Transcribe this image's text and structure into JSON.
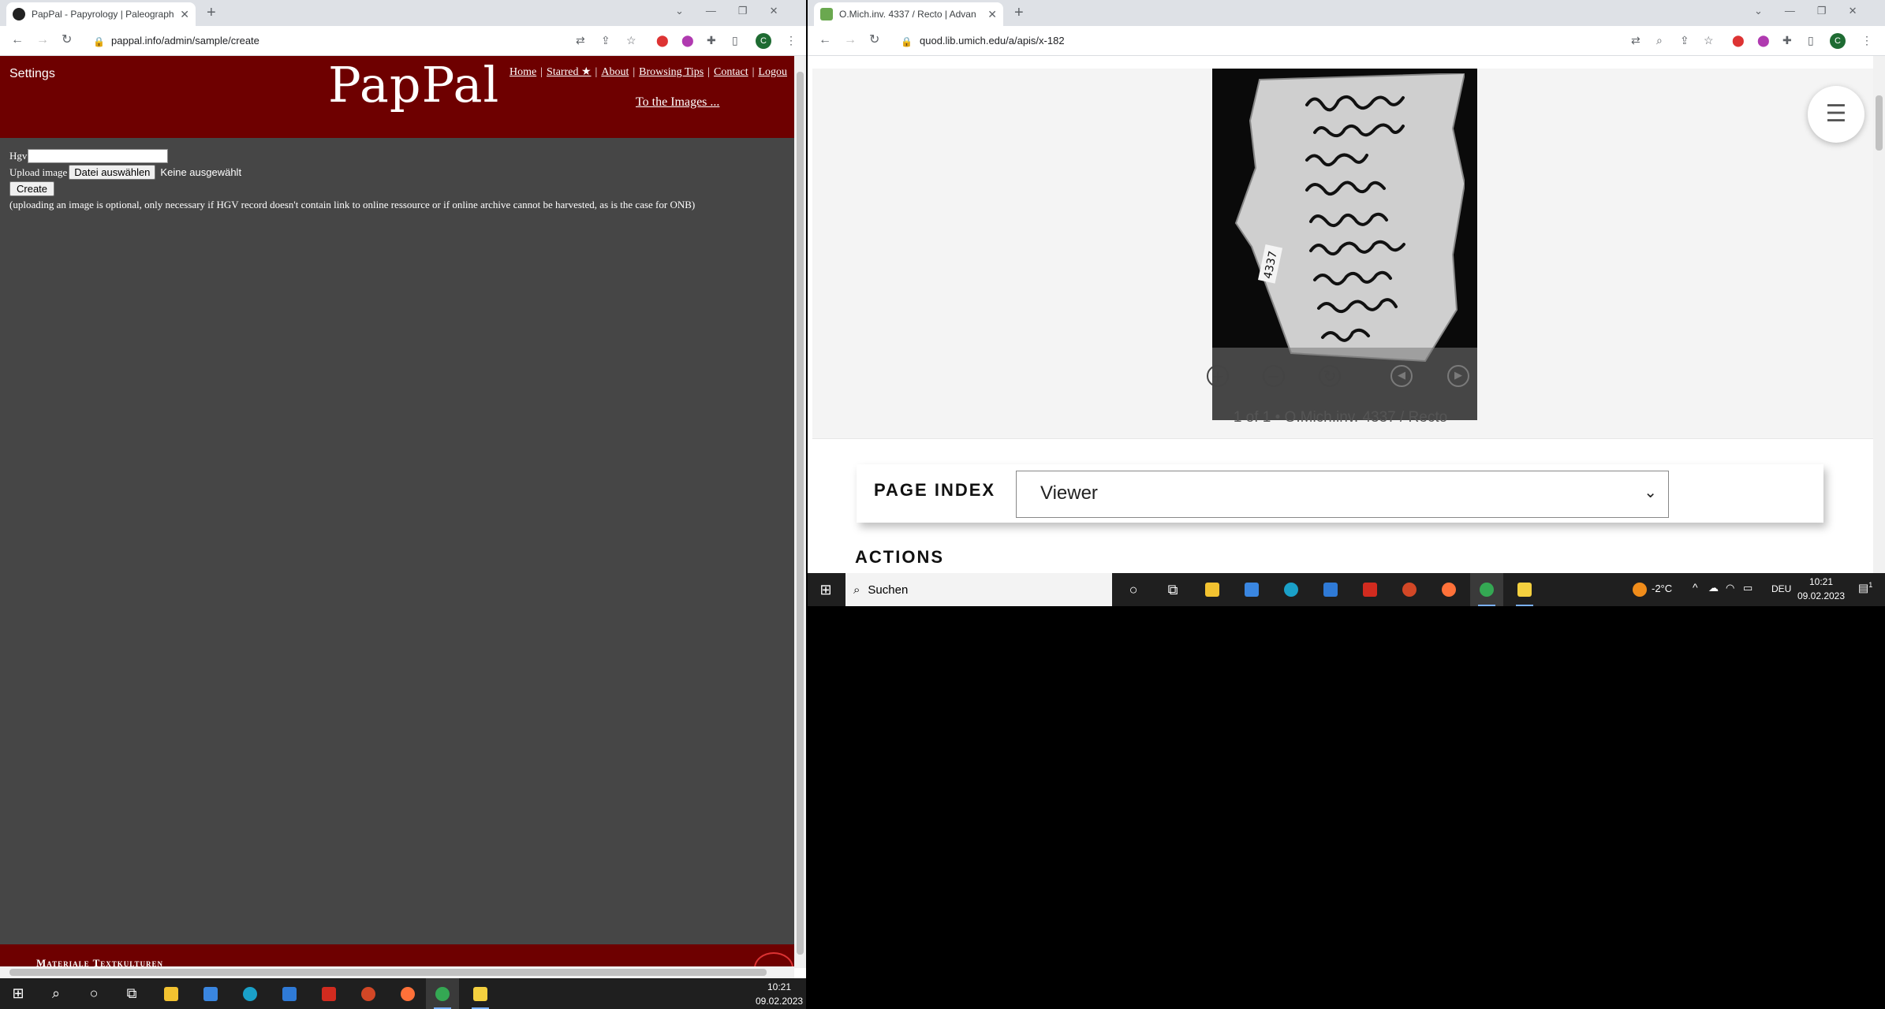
{
  "left_window": {
    "tab_title": "PapPal - Papyrology | Paleograph",
    "url": "pappal.info/admin/sample/create",
    "pappal": {
      "settings": "Settings",
      "logo": "PapPal",
      "nav": [
        "Home",
        "Starred ★",
        "About",
        "Browsing Tips",
        "Contact",
        "Logou"
      ],
      "to_images": "To the Images ...",
      "form": {
        "hgv_label": "Hgv",
        "hgv_value": "",
        "upload_label": "Upload image",
        "file_button": "Datei auswählen",
        "file_status": "Keine ausgewählt",
        "create_button": "Create",
        "note": "(uploading an image is optional, only necessary if HGV record doesn't contain link to online ressource or if online archive cannot be harvested, as is the case for ONB)"
      },
      "footer_text": "Materiale Textkulturen"
    }
  },
  "right_window": {
    "tab_title": "O.Mich.inv. 4337 / Recto | Advan",
    "url": "quod.lib.umich.edu/a/apis/x-182",
    "viewer": {
      "caption": "1 of 1 • O.Mich.inv. 4337 / Recto",
      "controls": [
        "zoom-in",
        "zoom-out",
        "rotate",
        "previous",
        "next"
      ]
    },
    "page_index_label": "PAGE INDEX",
    "page_index_value": "Viewer",
    "actions_heading": "ACTIONS"
  },
  "taskbar_left": {
    "time": "10:21",
    "date": "09.02.2023"
  },
  "taskbar_right": {
    "search_placeholder": "Suchen",
    "weather": "-2°C",
    "language": "DEU",
    "time": "10:21",
    "date": "09.02.2023",
    "notifications": "1"
  },
  "colors": {
    "pappal_red": "#6e0000",
    "pappal_body": "#464646",
    "chrome_tabstrip": "#dee1e6",
    "taskbar": "#1f1f1f"
  }
}
